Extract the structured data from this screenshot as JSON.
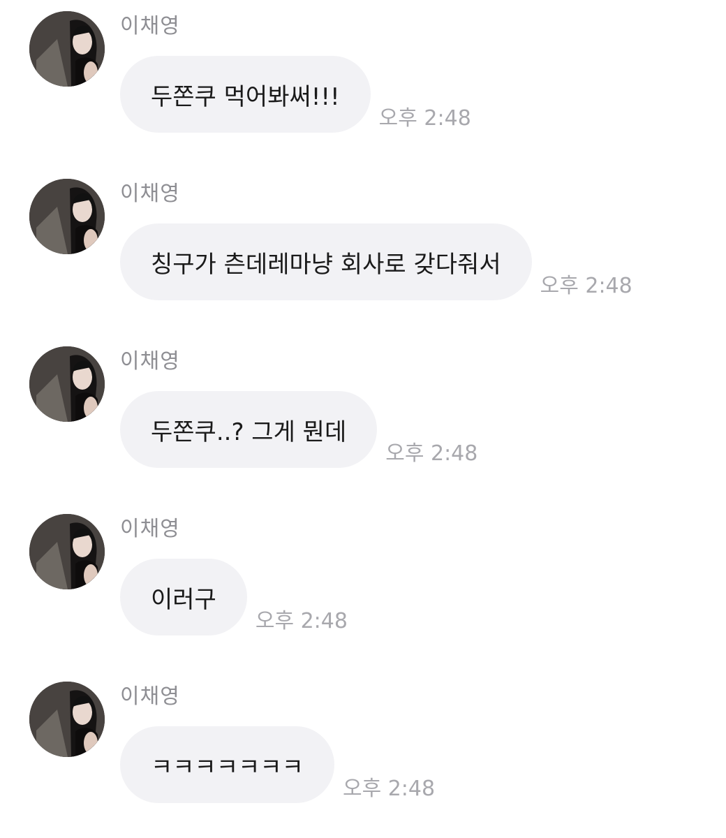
{
  "messages": [
    {
      "sender": "이채영",
      "text": "두쫀쿠 먹어봐써!!!",
      "time": "오후 2:48"
    },
    {
      "sender": "이채영",
      "text": "칭구가 츤데레마냥 회사로 갖다줘서",
      "time": "오후 2:48"
    },
    {
      "sender": "이채영",
      "text": "두쫀쿠..? 그게 뭔데",
      "time": "오후 2:48"
    },
    {
      "sender": "이채영",
      "text": "이러구",
      "time": "오후 2:48"
    },
    {
      "sender": "이채영",
      "text": "ㅋㅋㅋㅋㅋㅋㅋ",
      "time": "오후 2:48"
    }
  ]
}
